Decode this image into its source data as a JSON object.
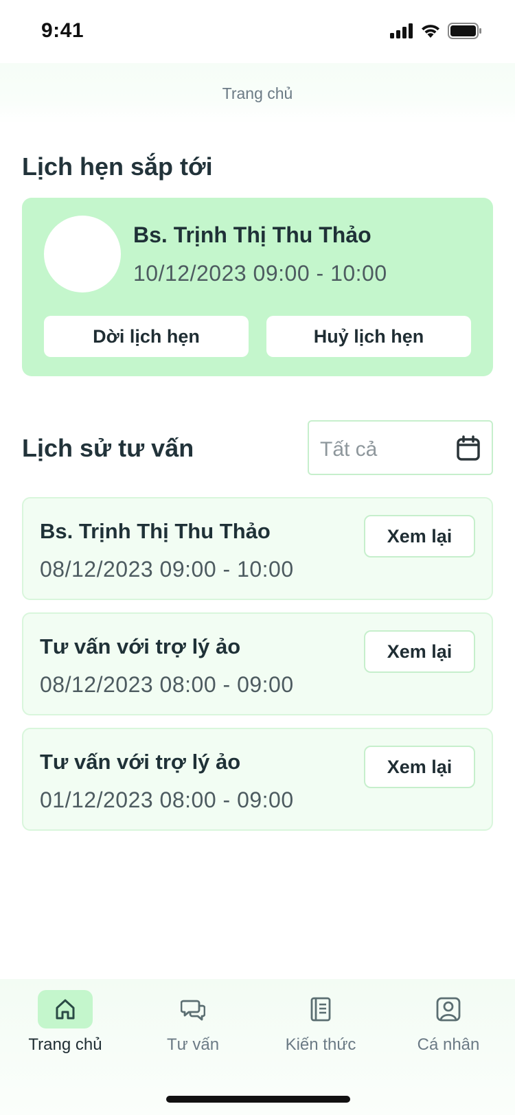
{
  "status_bar": {
    "time": "9:41"
  },
  "header": {
    "title": "Trang chủ"
  },
  "upcoming": {
    "section_title": "Lịch hẹn sắp tới",
    "doctor": "Bs. Trịnh Thị Thu Thảo",
    "datetime": "10/12/2023  09:00 - 10:00",
    "reschedule_label": "Dời lịch hẹn",
    "cancel_label": "Huỷ lịch hẹn"
  },
  "history": {
    "section_title": "Lịch sử tư vấn",
    "filter_value": "Tất cả",
    "items": [
      {
        "title": "Bs. Trịnh Thị Thu Thảo",
        "datetime": "08/12/2023  09:00 - 10:00",
        "action": "Xem lại"
      },
      {
        "title": "Tư vấn với trợ lý ảo",
        "datetime": "08/12/2023  08:00 - 09:00",
        "action": "Xem lại"
      },
      {
        "title": "Tư vấn với trợ lý ảo",
        "datetime": "01/12/2023  08:00 - 09:00",
        "action": "Xem lại"
      }
    ]
  },
  "tabs": [
    {
      "label": "Trang chủ",
      "icon": "home-icon",
      "active": true
    },
    {
      "label": "Tư vấn",
      "icon": "chat-icon",
      "active": false
    },
    {
      "label": "Kiến thức",
      "icon": "book-icon",
      "active": false
    },
    {
      "label": "Cá nhân",
      "icon": "profile-icon",
      "active": false
    }
  ],
  "colors": {
    "accent": "#c4f6cc",
    "card_bg": "#f2fdf3",
    "border": "#c6efcc",
    "text": "#1f3137"
  }
}
